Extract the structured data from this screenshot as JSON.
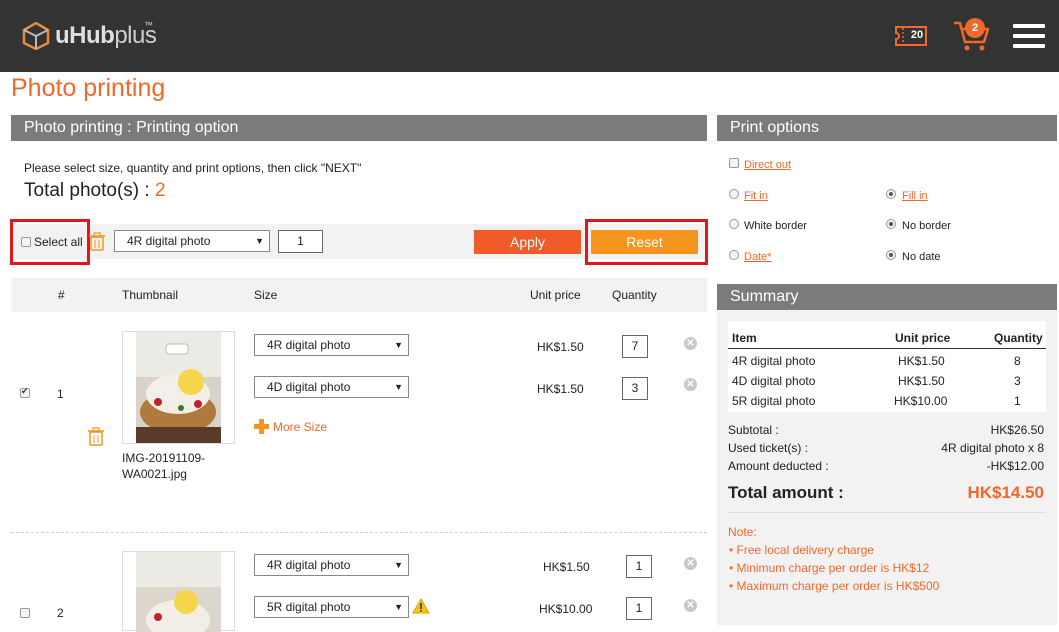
{
  "header": {
    "logo_text_bold": "uHub",
    "logo_text_light": "plus",
    "logo_tm": "™",
    "ticket_count": "20",
    "cart_count": "2"
  },
  "page_title": "Photo printing",
  "left_panel": {
    "heading": "Photo printing : Printing option",
    "instruction": "Please select size, quantity and print options, then click \"NEXT\"",
    "total_label": "Total photo(s) : ",
    "total_value": "2"
  },
  "toolbar": {
    "select_all_label": "Select all",
    "size_value": "4R digital photo",
    "qty_value": "1",
    "apply_label": "Apply",
    "reset_label": "Reset"
  },
  "table": {
    "headers": [
      "#",
      "Thumbnail",
      "Size",
      "Unit price",
      "Quantity"
    ],
    "rows": [
      {
        "checked": true,
        "index": "1",
        "filename_line1": "IMG-20191109-",
        "filename_line2": "WA0021.jpg",
        "sizes": [
          {
            "size": "4R digital photo",
            "price": "HK$1.50",
            "qty": "7",
            "warning": false
          },
          {
            "size": "4D digital photo",
            "price": "HK$1.50",
            "qty": "3",
            "warning": false
          }
        ],
        "more_size_label": "More Size"
      },
      {
        "checked": false,
        "index": "2",
        "sizes": [
          {
            "size": "4R digital photo",
            "price": "HK$1.50",
            "qty": "1",
            "warning": false
          },
          {
            "size": "5R digital photo",
            "price": "HK$10.00",
            "qty": "1",
            "warning": true
          }
        ]
      }
    ]
  },
  "print_options": {
    "heading": "Print options",
    "direct_out": "Direct out",
    "fit_in": "Fit in",
    "fill_in": "Fill in",
    "white_border": "White border",
    "no_border": "No border",
    "date": "Date*",
    "no_date": "No date",
    "selected": {
      "fill": "fill_in",
      "border": "no_border",
      "date": "no_date"
    }
  },
  "summary": {
    "heading": "Summary",
    "headers": [
      "Item",
      "Unit price",
      "Quantity"
    ],
    "rows": [
      {
        "item": "4R digital photo",
        "price": "HK$1.50",
        "qty": "8"
      },
      {
        "item": "4D digital photo",
        "price": "HK$1.50",
        "qty": "3"
      },
      {
        "item": "5R digital photo",
        "price": "HK$10.00",
        "qty": "1"
      }
    ],
    "subtotal_label": "Subtotal :",
    "subtotal_value": "HK$26.50",
    "tickets_label": "Used ticket(s) :",
    "tickets_value": "4R digital photo x 8",
    "deducted_label": "Amount deducted :",
    "deducted_value": "-HK$12.00",
    "total_label": "Total amount :",
    "total_value": "HK$14.50"
  },
  "note": {
    "label": "Note:",
    "items": [
      "Free local delivery charge",
      "Minimum charge per order is HK$12",
      "Maximum charge per order is HK$500"
    ]
  },
  "colors": {
    "accent": "#f0682a",
    "reset_button": "#f7941d",
    "header_bg": "#333333",
    "panel_head": "#7b7b7b",
    "highlight_box": "#e4161c"
  }
}
